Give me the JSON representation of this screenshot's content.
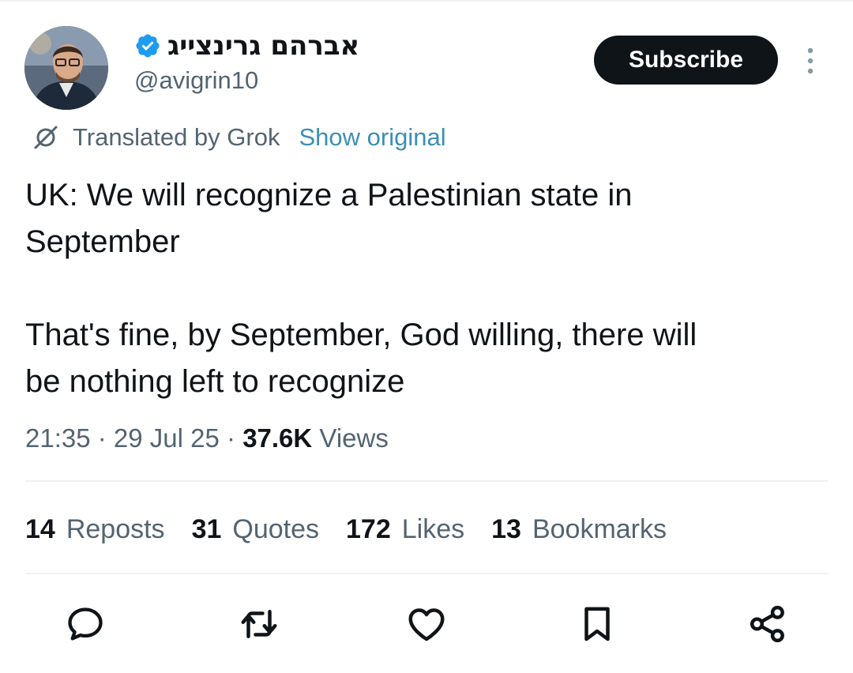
{
  "author": {
    "display_name": "אברהם גרינצייג",
    "handle": "@avigrin10",
    "verified": true
  },
  "header": {
    "subscribe_label": "Subscribe"
  },
  "translation": {
    "label": "Translated by Grok",
    "show_original_label": "Show original"
  },
  "tweet": {
    "text": "UK: We will recognize a Palestinian state in\nSeptember\n\nThat's fine, by September, God willing, there will\nbe nothing left to recognize",
    "time": "21:35",
    "date": "29 Jul 25",
    "views_count": "37.6K",
    "views_label": "Views"
  },
  "stats": {
    "reposts": {
      "count": "14",
      "label": "Reposts"
    },
    "quotes": {
      "count": "31",
      "label": "Quotes"
    },
    "likes": {
      "count": "172",
      "label": "Likes"
    },
    "bookmarks": {
      "count": "13",
      "label": "Bookmarks"
    }
  },
  "actions": [
    "reply-icon",
    "retweet-icon",
    "like-icon",
    "bookmark-icon",
    "share-icon"
  ],
  "colors": {
    "text_primary": "#0f1419",
    "text_secondary": "#536471",
    "link": "#3a8fb5",
    "verified": "#1d9bf0",
    "button_bg": "#0f1419"
  }
}
